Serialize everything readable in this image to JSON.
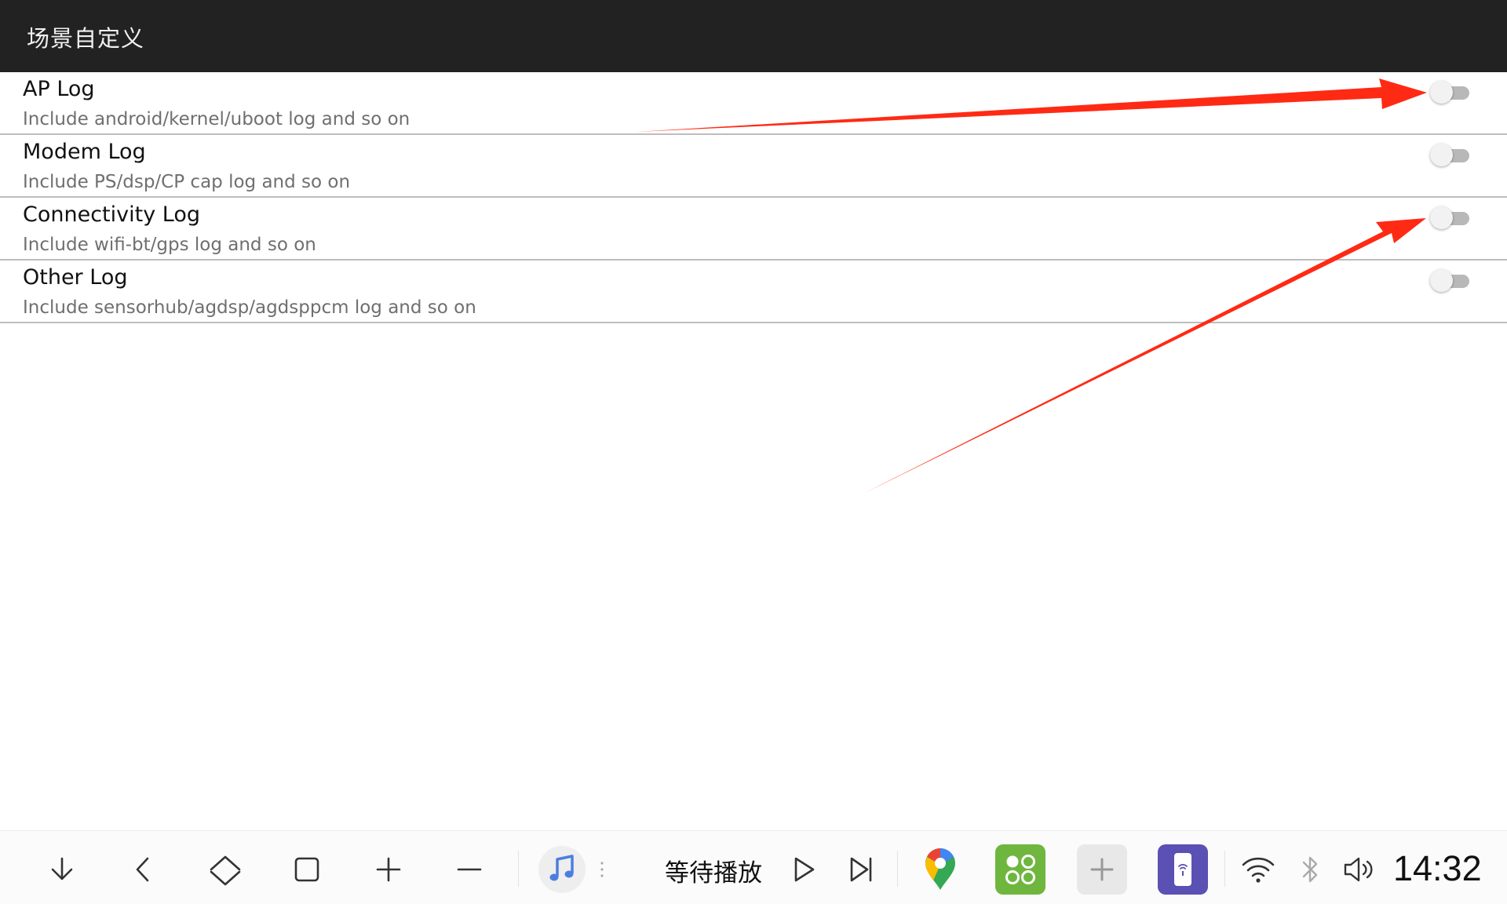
{
  "app": {
    "title": "场景自定义"
  },
  "settings": [
    {
      "title": "AP Log",
      "subtitle": "Include android/kernel/uboot log and so on",
      "enabled": false
    },
    {
      "title": "Modem Log",
      "subtitle": "Include PS/dsp/CP cap log and so on",
      "enabled": false
    },
    {
      "title": "Connectivity Log",
      "subtitle": "Include wifi-bt/gps log and so on",
      "enabled": false
    },
    {
      "title": "Other Log",
      "subtitle": "Include sensorhub/agdsp/agdsppcm log and so on",
      "enabled": false
    }
  ],
  "annotations": {
    "arrow_color": "#ff2a14"
  },
  "navbar": {
    "media_label": "等待播放",
    "time": "14:32",
    "icons": [
      "chevron-down-icon",
      "back-icon",
      "home-icon",
      "recents-icon",
      "volume-up-icon",
      "volume-down-icon",
      "music-icon",
      "play-icon",
      "skip-next-icon",
      "maps-icon",
      "apps-icon",
      "add-icon",
      "phone-link-icon",
      "wifi-icon",
      "bluetooth-icon",
      "speaker-icon"
    ]
  },
  "colors": {
    "appbar": "#222222",
    "text_primary": "#111111",
    "text_secondary": "#6f6f6f",
    "divider": "#bdbdbd"
  }
}
